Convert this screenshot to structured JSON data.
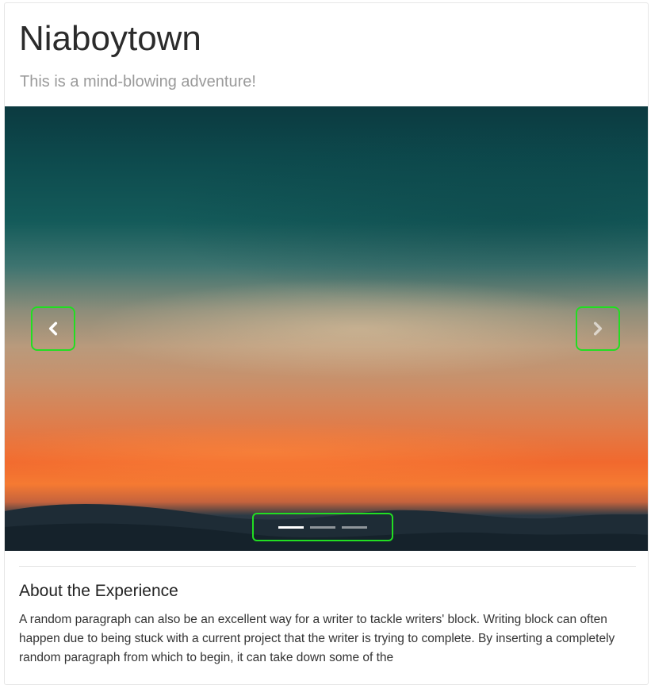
{
  "header": {
    "title": "Niaboytown",
    "subtitle": "This is a mind-blowing adventure!"
  },
  "carousel": {
    "prev_icon": "chevron-left-icon",
    "next_icon": "chevron-right-icon",
    "slide_count": 3,
    "active_index": 0
  },
  "section": {
    "heading": "About the Experience",
    "body": "A random paragraph can also be an excellent way for a writer to tackle writers' block. Writing block can often happen due to being stuck with a current project that the writer is trying to complete. By inserting a completely random paragraph from which to begin, it can take down some of the"
  },
  "colors": {
    "highlight": "#22dd22",
    "subtitle": "#9a9a9a"
  }
}
